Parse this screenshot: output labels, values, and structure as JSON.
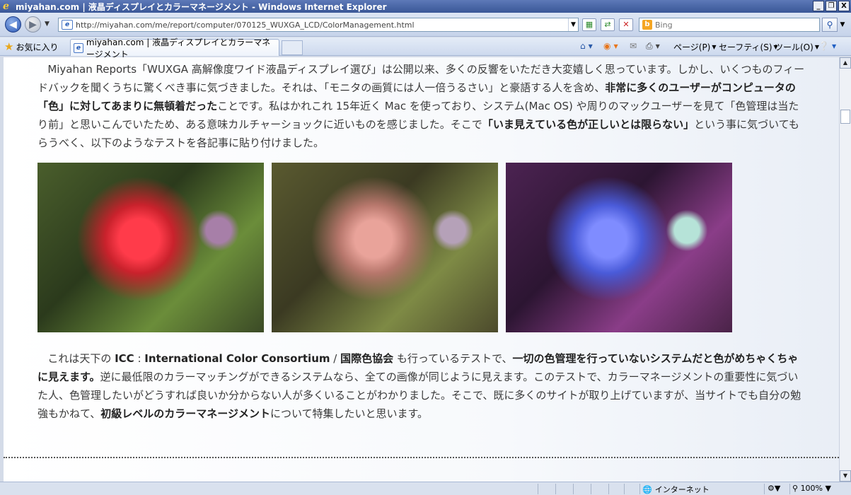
{
  "window": {
    "title": "miyahan.com | 液晶ディスプレイとカラーマネージメント - Windows Internet Explorer",
    "minimize": "_",
    "restore": "❐",
    "close": "X"
  },
  "nav": {
    "back_icon": "back-arrow-icon",
    "forward_icon": "forward-arrow-icon",
    "url": "http://miyahan.com/me/report/computer/070125_WUXGA_LCD/ColorManagement.html",
    "search_placeholder": "Bing"
  },
  "favorites": {
    "label": "お気に入り"
  },
  "tab": {
    "title": "miyahan.com | 液晶ディスプレイとカラーマネージメント"
  },
  "commands": {
    "page": "ページ(P)",
    "safety": "セーフティ(S)",
    "tools": "ツール(O)"
  },
  "content": {
    "p1_a": "Miyahan Reports「WUXGA 高解像度ワイド液晶ディスプレイ選び」は公開以来、多くの反響をいただき大変嬉しく思っています。しかし、いくつものフィードバックを聞くうちに驚くべき事に気づきました。それは、「モニタの画質には人一倍うるさい」と豪語する人を含め、",
    "p1_b": "非常に多くのユーザーがコンピュータの「色」に対してあまりに無頓着だった",
    "p1_c": "ことです。私はかれこれ 15年近く Mac を使っており、システム(Mac OS) や周りのマックユーザーを見て「色管理は当たり前」と思いこんでいたため、ある意味カルチャーショックに近いものを感じました。そこで",
    "p1_d": "「いま見えている色が正しいとは限らない」",
    "p1_e": "という事に気づいてもらうべく、以下のようなテストを各記事に貼り付けました。",
    "p2_a": "これは天下の ",
    "p2_b": "ICC",
    "p2_c": " : ",
    "p2_d": "International Color Consortium",
    "p2_e": " / ",
    "p2_f": "国際色協会",
    "p2_g": " も行っているテストで、",
    "p2_h": "一切の色管理を行っていないシステムだと色がめちゃくちゃに見えます。",
    "p2_i": "逆に最低限のカラーマッチングができるシステムなら、全ての画像が同じように見えます。このテストで、カラーマネージメントの重要性に気づいた人、色管理したいがどうすれば良いか分からない人が多くいることがわかりました。そこで、既に多くのサイトが取り上げていますが、当サイトでも自分の勉強もかねて、",
    "p2_j": "初級レベルのカラーマネージメント",
    "p2_k": "について特集したいと思います。"
  },
  "status": {
    "zone": "インターネット",
    "zoom": "100%"
  }
}
